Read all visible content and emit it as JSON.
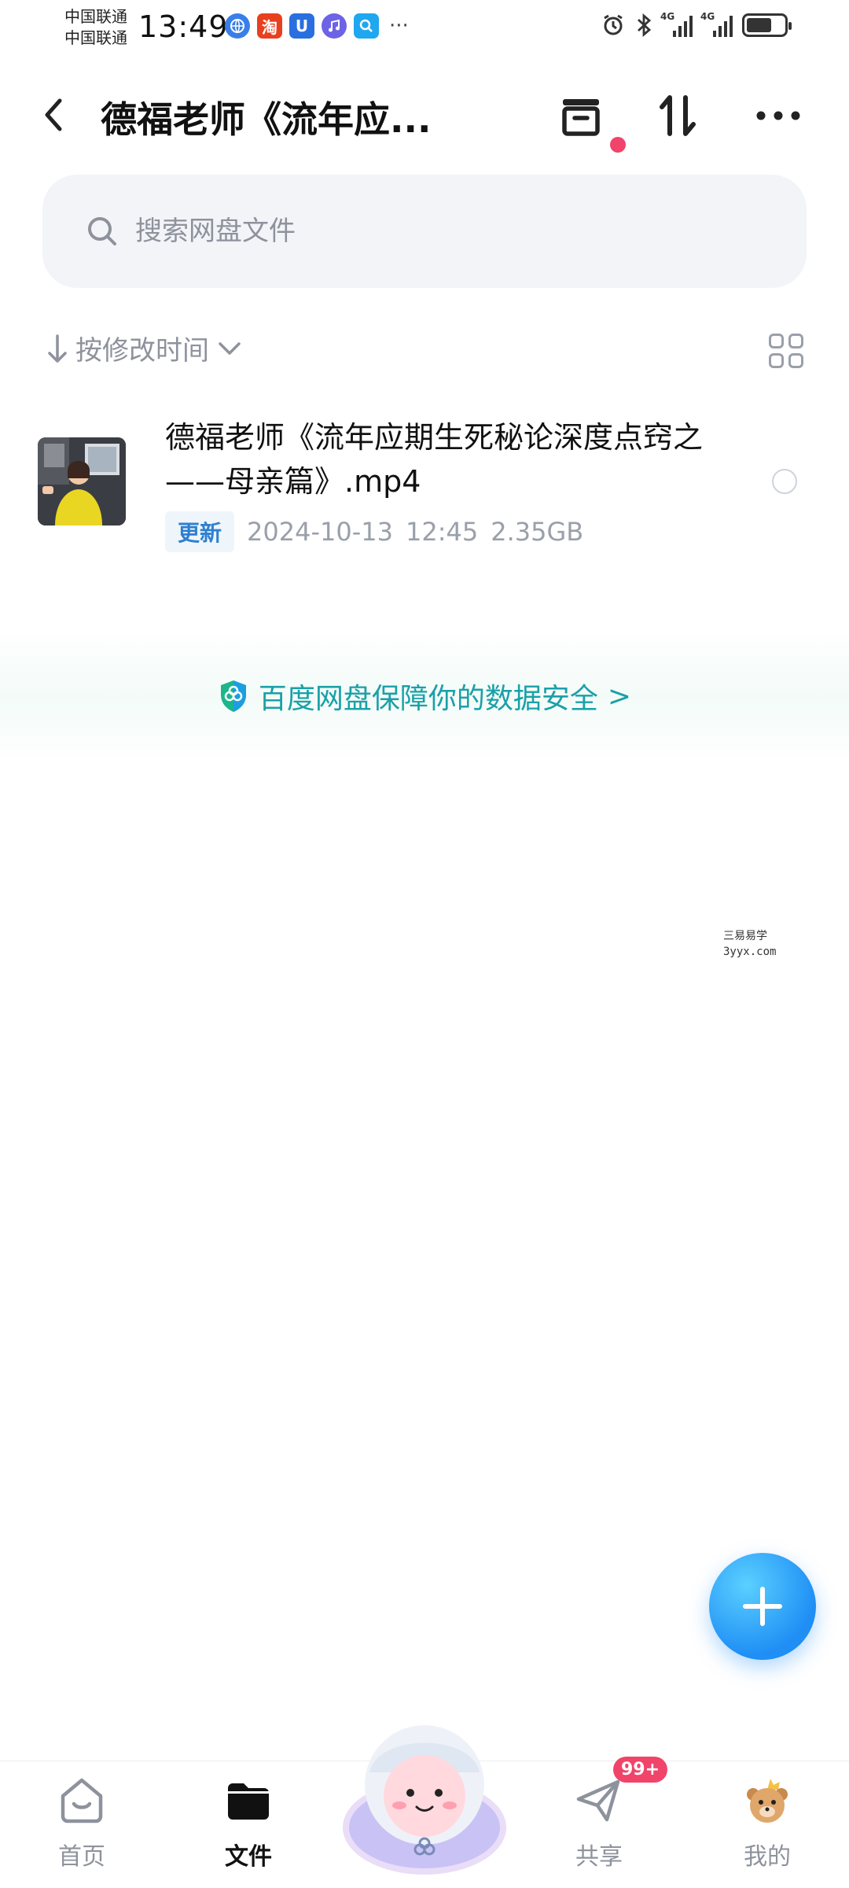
{
  "status_bar": {
    "carrier_1": "中国联通",
    "carrier_2": "中国联通",
    "time": "13:49",
    "notification_icons": [
      "browser-icon",
      "taobao-icon",
      "app-u-icon",
      "music-icon",
      "search-app-icon"
    ],
    "taobao_glyph": "淘",
    "u_glyph": "U",
    "more": "···",
    "network_1": "4G",
    "network_2": "4G"
  },
  "header": {
    "title": "德福老师《流年应...",
    "transfer_dot_color": "#f0446a"
  },
  "search": {
    "placeholder": "搜索网盘文件"
  },
  "sort": {
    "label": "按修改时间"
  },
  "files": [
    {
      "name": "德福老师《流年应期生死秘论深度点窍之——母亲篇》.mp4",
      "badge": "更新",
      "date": "2024-10-13",
      "time": "12:45",
      "size": "2.35GB"
    }
  ],
  "security_banner": {
    "text": "百度网盘保障你的数据安全",
    "chevron": ">",
    "color": "#1aa0a8"
  },
  "watermark": {
    "line1": "三易易学",
    "line2": "3yyx.com"
  },
  "bottom_nav": {
    "items": [
      {
        "label": "首页",
        "icon": "home-icon"
      },
      {
        "label": "文件",
        "icon": "folder-icon"
      },
      {
        "label": "",
        "icon": "mascot-icon"
      },
      {
        "label": "共享",
        "icon": "share-icon"
      },
      {
        "label": "我的",
        "icon": "profile-icon"
      }
    ],
    "share_badge": "99+"
  },
  "colors": {
    "accent": "#1f8ef5",
    "badge_red": "#f0446a",
    "text_secondary": "#8e929c"
  }
}
